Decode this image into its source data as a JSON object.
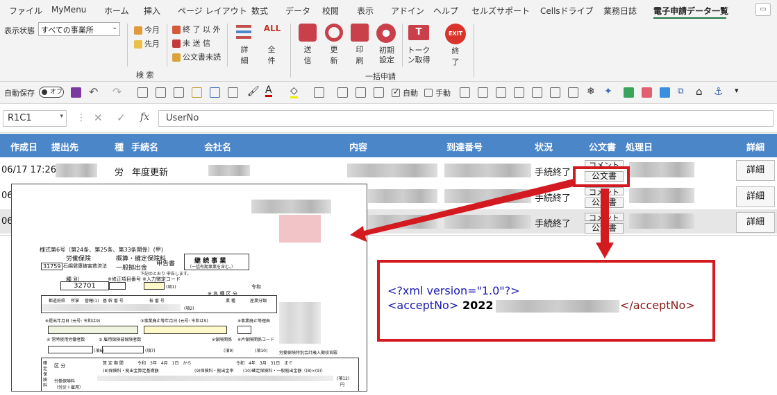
{
  "ribbon_tabs": [
    "ファイル",
    "MyMenu",
    "ホーム",
    "挿入",
    "ページ レイアウト",
    "数式",
    "データ",
    "校閲",
    "表示",
    "アドイン",
    "ヘルプ",
    "セルズサポート",
    "Cellsドライブ",
    "業務日誌",
    "電子申請データ一覧"
  ],
  "ribbon": {
    "display_state_label": "表示状態",
    "display_state_value": "すべての事業所",
    "filter_this_month": "今月",
    "filter_last_month": "先月",
    "filter_exclude_done": "終 了 以 外",
    "filter_unsent": "未 送 信",
    "filter_unread_official": "公文書未読",
    "detail_label": "詳細",
    "all_label": "全件",
    "group_search": "検 索",
    "send_label": "送信",
    "refresh_label": "更新",
    "print_label": "印刷",
    "init_settings_label": "初期設定",
    "token_label": "トークン取得",
    "exit_label": "終了",
    "exit_icon_text": "EXIT",
    "all_icon_text": "ALL",
    "group_bulk": "一括申請"
  },
  "qat": {
    "autosave_label": "自動保存",
    "autosave_state": "オフ",
    "auto_label": "自動",
    "manual_label": "手動"
  },
  "formula_bar": {
    "name_box": "R1C1",
    "fx": "fx",
    "value": "UserNo"
  },
  "table": {
    "headers": [
      "作成日",
      "提出先",
      "種",
      "手続名",
      "会社名",
      "内容",
      "到達番号",
      "状況",
      "公文書",
      "処理日",
      "詳細"
    ],
    "rows": [
      {
        "date": "06/17 17:26",
        "kind": "労",
        "procedure": "年度更新",
        "status": "手続終了",
        "comment": "コメント",
        "official": "公文書",
        "detail": "詳細"
      },
      {
        "date": "06/",
        "kind": "",
        "procedure": "",
        "status": "手続終了",
        "comment": "コメント",
        "official": "公文書",
        "detail": "詳細"
      },
      {
        "date": "06/",
        "kind": "",
        "procedure": "",
        "status": "手続終了",
        "comment": "コメント",
        "official": "公文書",
        "detail": "詳細"
      }
    ]
  },
  "document": {
    "form_no": "様式第6号（第24条、第25条、第33条関係）(甲)",
    "title_line1": "労働保険",
    "title_line2": "概算・確定保険料",
    "title_line3": "一般拠出金",
    "title_suffix": "申告書",
    "continuing": "継 続 事 業",
    "continuing_sub": "（一括有期事業を含む。）",
    "code": "31759",
    "damage_law": "石綿健康被害救済法",
    "instruction": "下記のとおり 申告します。",
    "type_label": "種 別",
    "type_value": "32701",
    "correction": "※修正項目番号",
    "input_code": "※入力徴定コード",
    "item1": "(項1)",
    "item2": "(項2)",
    "reiwa": "令和",
    "category": "※ 各 種 区 分",
    "industry": "業 種",
    "industry_class": "産業分類",
    "pref_label": "都道府県",
    "branch_label": "所掌",
    "jurisdiction": "管轄(1)",
    "basic_no": "基 幹 番 号",
    "branch_no": "枝 番 号",
    "submit_date": "※提出年月日 (元号: 令和は9)",
    "end_date": "③事業廃止等年月日 (元号: 令和は9)",
    "end_reason": "※事業廃止等理由",
    "workers": "④ 常時使用労働者数",
    "insured": "⑤ 雇用保険被保険者数",
    "insurance_rel": "※保険関係",
    "joint": "※片保険関係コード",
    "item6": "(項6)",
    "item7": "(項7)",
    "item9": "(項9)",
    "item10": "(項10)",
    "special": "労働保険特別会計歳入徴収官殿",
    "period": "算 定 期 間",
    "period_from": "令和　3年　4月　1日　から",
    "period_to": "令和　4年　3月　31日　まで",
    "section": "区 分",
    "premium_base": "(8)保険料・拠出金算定基礎額",
    "rate": "(9)保険料・拠出金率",
    "confirmed": "(10)確定保険料・一般拠出金額（(8)×(9)）",
    "labor_ins": "労働保険料",
    "labor_kind": "（労災＋雇用）",
    "item12": "(項12)",
    "yen": "円",
    "side_label": "確定保険料"
  },
  "xml": {
    "line1": "<?xml version=\"1.0\"?>",
    "open_tag": "<acceptNo>",
    "value_prefix": "2022",
    "close_tag": "</acceptNo>"
  },
  "colors": {
    "header_blue": "#4b86c9",
    "row_gray": "#e6e6e6",
    "highlight_red": "#d31a20",
    "excel_green": "#217346",
    "xml_blue": "#1a1ab0",
    "xml_red": "#8b1a1a"
  }
}
